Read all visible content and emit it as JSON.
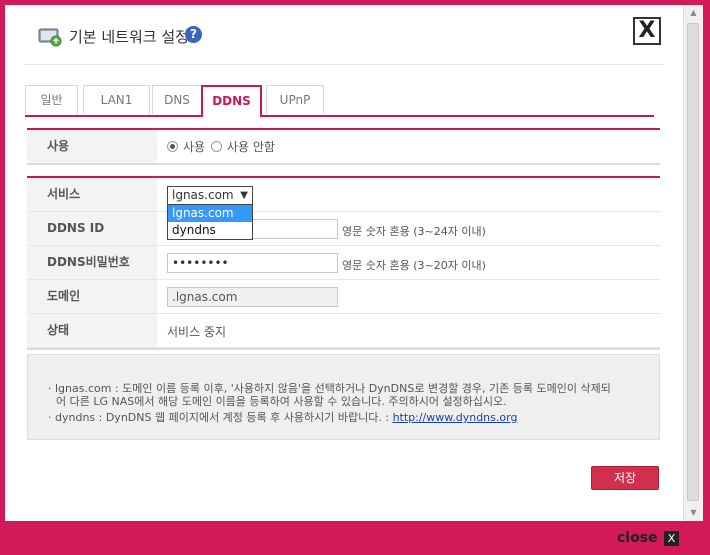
{
  "dialog": {
    "title": "기본 네트워크 설정",
    "help_glyph": "?",
    "close_glyph": "X"
  },
  "tabs": [
    {
      "label": "일반",
      "active": false
    },
    {
      "label": "LAN1",
      "active": false
    },
    {
      "label": "DNS",
      "active": false
    },
    {
      "label": "DDNS",
      "active": true
    },
    {
      "label": "UPnP",
      "active": false
    }
  ],
  "usage": {
    "label": "사용",
    "options": [
      "사용",
      "사용 안함"
    ],
    "selected": "사용"
  },
  "service": {
    "label": "서비스",
    "selected": "lgnas.com",
    "options": [
      "lgnas.com",
      "dyndns"
    ]
  },
  "ddns_id": {
    "label": "DDNS ID",
    "value": "",
    "hint": "영문 숫자 혼용 (3~24자 이내)"
  },
  "ddns_password": {
    "label": "DDNS비밀번호",
    "value": "••••••••",
    "hint": "영문 숫자 혼용 (3~20자 이내)"
  },
  "domain": {
    "label": "도메인",
    "value": ".lgnas.com"
  },
  "status": {
    "label": "상태",
    "value": "서비스 중지"
  },
  "notes": {
    "line1": "· lgnas.com : 도메인 이름 등록 이후, '사용하지 않음'을 선택하거나 DynDNS로 변경할 경우, 기존 등록 도메인이 삭제되",
    "line2": "어 다른 LG NAS에서 해당 도메인 이름을 등록하여 사용할 수 있습니다. 주의하시어 설정하십시오.",
    "line3": "· dyndns : DynDNS 웹 페이지에서 계정 등록 후 사용하시기 바랍니다. :",
    "link": "http://www.dyndns.org"
  },
  "buttons": {
    "save": "저장"
  },
  "footer": {
    "close_label": "close",
    "close_glyph": "X"
  },
  "colors": {
    "accent": "#c8185a",
    "frame": "#d2195a",
    "save_button": "#d0304d",
    "link": "#1a3fb4"
  }
}
